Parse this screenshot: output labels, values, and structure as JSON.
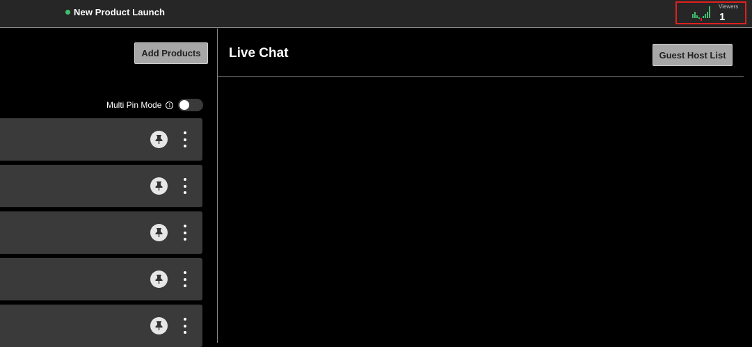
{
  "topbar": {
    "event_title": "New Product Launch",
    "live_status_color": "#3fbf6f",
    "viewers": {
      "label": "Viewers",
      "count": "1",
      "highlight_color": "#e02020",
      "chart_icon": "viewers-activity-chart-icon"
    }
  },
  "left_panel": {
    "add_products_label": "Add Products",
    "multi_pin_mode": {
      "label": "Multi Pin Mode",
      "info_icon": "info-icon",
      "enabled": false
    },
    "product_rows": [
      {
        "pin_icon": "pin-icon",
        "more_icon": "more-vertical-icon"
      },
      {
        "pin_icon": "pin-icon",
        "more_icon": "more-vertical-icon"
      },
      {
        "pin_icon": "pin-icon",
        "more_icon": "more-vertical-icon"
      },
      {
        "pin_icon": "pin-icon",
        "more_icon": "more-vertical-icon"
      },
      {
        "pin_icon": "pin-icon",
        "more_icon": "more-vertical-icon"
      }
    ]
  },
  "chat": {
    "title": "Live Chat",
    "guest_host_list_label": "Guest Host List"
  },
  "colors": {
    "background": "#000000",
    "topbar": "#262626",
    "row": "#3a3a3a",
    "button": "#a7a7a7"
  }
}
